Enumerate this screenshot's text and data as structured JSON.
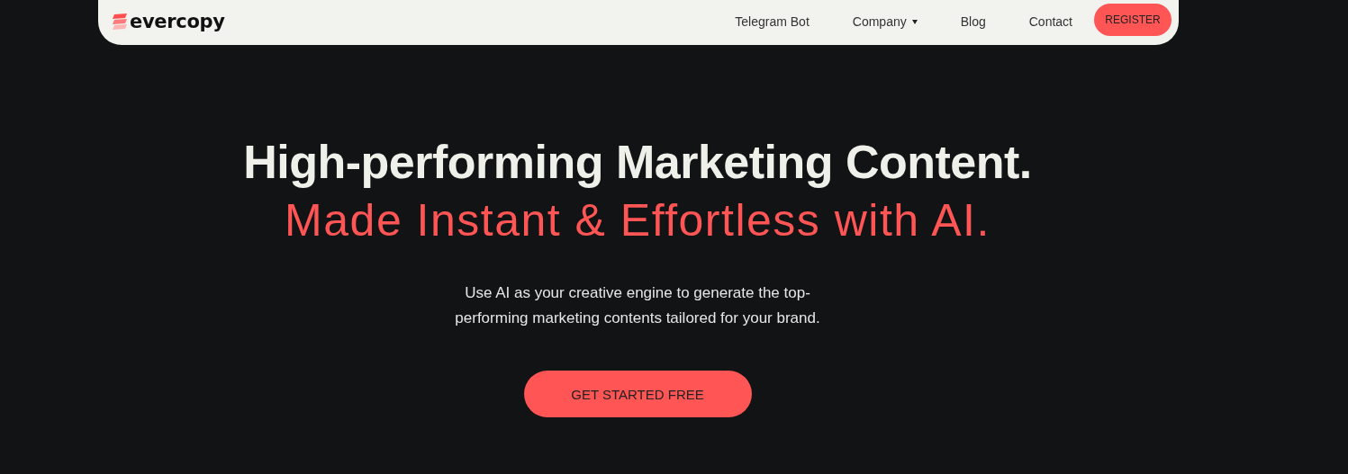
{
  "navbar": {
    "logo": "evercopy",
    "links": [
      {
        "label": "Telegram Bot",
        "kind": "link"
      },
      {
        "label": "Company",
        "kind": "dropdown"
      },
      {
        "label": "Blog",
        "kind": "link"
      },
      {
        "label": "Contact",
        "kind": "link"
      }
    ],
    "button": "REGISTER"
  },
  "hero": {
    "headline": "High-performing Marketing Content.",
    "tagline": "Made Instant & Effortless with AI.",
    "description": "Use AI as your creative engine to generate the top-performing marketing contents tailored for your brand.",
    "button": "GET STARTED FREE"
  }
}
